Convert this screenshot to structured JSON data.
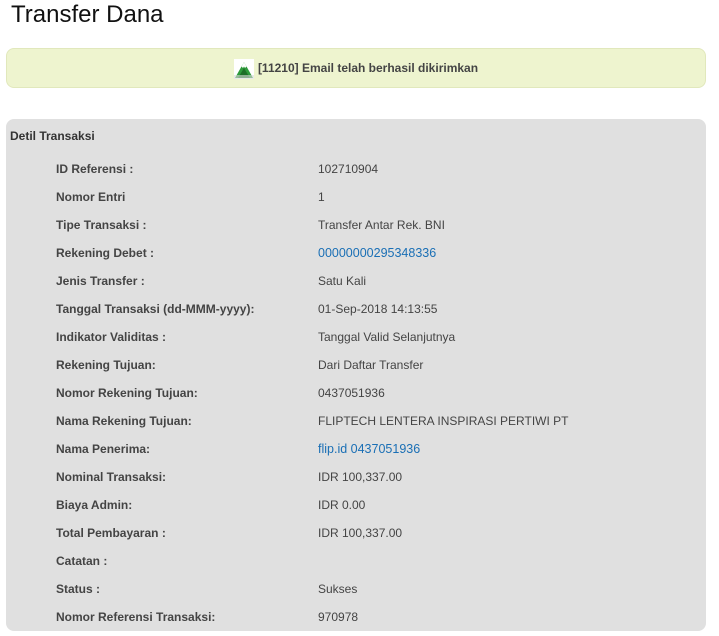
{
  "page": {
    "title": "Transfer Dana"
  },
  "notice": {
    "icon": "success-mountain-icon",
    "message": "[11210] Email telah berhasil dikirimkan",
    "background": "#eef4cf"
  },
  "detail": {
    "title": "Detil Transaksi",
    "rows": [
      {
        "label": "ID Referensi :",
        "value": "102710904"
      },
      {
        "label": "Nomor Entri",
        "value": "1"
      },
      {
        "label": "Tipe Transaksi :",
        "value": "Transfer Antar Rek. BNI"
      },
      {
        "label": "Rekening Debet :",
        "value": "00000000295348336"
      },
      {
        "label": "Jenis Transfer :",
        "value": "Satu Kali"
      },
      {
        "label": "Tanggal Transaksi (dd-MMM-yyyy):",
        "value": "01-Sep-2018 14:13:55"
      },
      {
        "label": "Indikator Validitas :",
        "value": "Tanggal Valid Selanjutnya"
      },
      {
        "label": "Rekening Tujuan:",
        "value": "Dari Daftar Transfer"
      },
      {
        "label": "Nomor Rekening Tujuan:",
        "value": "0437051936"
      },
      {
        "label": "Nama Rekening Tujuan:",
        "value": "FLIPTECH LENTERA INSPIRASI PERTIWI PT"
      },
      {
        "label": "Nama Penerima:",
        "value": "flip.id 0437051936"
      },
      {
        "label": "Nominal Transaksi:",
        "value": "IDR 100,337.00"
      },
      {
        "label": "Biaya Admin:",
        "value": "IDR 0.00"
      },
      {
        "label": "Total Pembayaran :",
        "value": "IDR 100,337.00"
      },
      {
        "label": "Catatan :",
        "value": ""
      },
      {
        "label": "Status :",
        "value": "Sukses"
      },
      {
        "label": "Nomor Referensi Transaksi:",
        "value": "970978"
      }
    ]
  },
  "colors": {
    "link": "#1a6fb5",
    "panel": "#e0e0e0"
  }
}
